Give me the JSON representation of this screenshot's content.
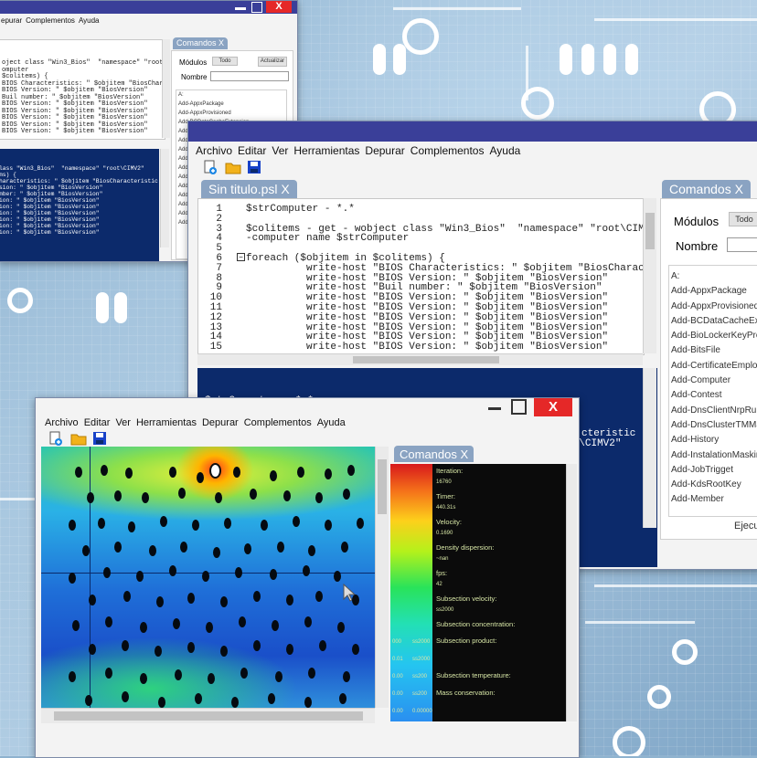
{
  "menu": [
    "Archivo",
    "Editar",
    "Ver",
    "Herramientas",
    "Depurar",
    "Complementos",
    "Ayuda"
  ],
  "back_window": {
    "menu": [
      "epurar",
      "Complementos",
      "Ayuda"
    ],
    "commands_tab": "Comandos  X",
    "modules_label": "Módulos",
    "modules_value": "Todo",
    "update_button": "Actualizar",
    "name_label": "Nombre",
    "commands": [
      "A:",
      "Add-AppxPackage",
      "Add-AppxProvisioned",
      "Add-BCDataCacheExtension",
      "Add-",
      "Add-",
      "Add-",
      "Add-",
      "Add-",
      "Add-",
      "Add-",
      "Add-",
      "Add-",
      "Add-",
      "Add-"
    ],
    "code": [
      "oject class \"Win3_Bios\"  \"namespace\" \"root\\CIMV",
      "omputer",
      "",
      "$colitems) {",
      "BIOS Characteristics: \" $objitem \"BiosCharacter",
      "BIOS Version: \" $objitem \"BiosVersion\"",
      "Buil number: \" $objitem \"BiosVersion\"",
      "BIOS Version: \" $objitem \"BiosVersion\"",
      "BIOS Version: \" $objitem \"BiosVersion\"",
      "BIOS Version: \" $objitem \"BiosVersion\"",
      "BIOS Version: \" $objitem \"BiosVersion\"",
      "BIOS Version: \" $objitem \"BiosVersion\""
    ],
    "console": [
      "lass \"Win3_Bios\"  \"namespace\" \"root\\CIMV2\"",
      "",
      "ms) {",
      "haracteristics: \" $objitem \"BiosCharacteristic",
      "sion: \" $objitem \"BiosVersion\"",
      "mber: \" $objitem \"BiosVersion\"",
      "ion: \" $objitem \"BiosVersion\"",
      "ion: \" $objitem \"BiosVersion\"",
      "ion: \" $objitem \"BiosVersion\"",
      "ion: \" $objitem \"BiosVersion\"",
      "ion: \" $objitem \"BiosVersion\"",
      "ion: \" $objitem \"BiosVersion\""
    ]
  },
  "mid_window": {
    "file_tab": "Sin titulo.psl  X",
    "commands_tab": "Comandos  X",
    "modules_label": "Módulos",
    "modules_value": "Todo",
    "name_label": "Nombre",
    "execute_button": "Ejecu",
    "commands": [
      "A:",
      "Add-AppxPackage",
      "Add-AppxProvisioned",
      "Add-BCDataCacheExt",
      "Add-BioLockerKeyPro",
      "Add-BitsFile",
      "Add-CertificateEmploy",
      "Add-Computer",
      "Add-Contest",
      "Add-DnsClientNrpRule",
      "Add-DnsClusterTMMa",
      "Add-History",
      "Add-InstalationMaskin",
      "Add-JobTrigget",
      "Add-KdsRootKey",
      "Add-Member"
    ],
    "line_numbers": [
      "1",
      "2",
      "3",
      "4",
      "5",
      "6",
      "7",
      "8",
      "9",
      "10",
      "11",
      "12",
      "13",
      "14",
      "15"
    ],
    "code": [
      "$strComputer - *.*",
      "",
      "$colitems - get - wobject class \"Win3_Bios\"  \"namespace\" \"root\\CIMV",
      "-computer name $strComputer",
      "",
      "foreach ($objitem in $colitems) {",
      "          write-host \"BIOS Characteristics: \" $objitem \"BiosCharacter",
      "          write-host \"BIOS Version: \" $objitem \"BiosVersion\"",
      "          write-host \"Buil number: \" $objitem \"BiosVersion\"",
      "          write-host \"BIOS Version: \" $objitem \"BiosVersion\"",
      "          write-host \"BIOS Version: \" $objitem \"BiosVersion\"",
      "          write-host \"BIOS Version: \" $objitem \"BiosVersion\"",
      "          write-host \"BIOS Version: \" $objitem \"BiosVersion\"",
      "          write-host \"BIOS Version: \" $objitem \"BiosVersion\"",
      "          write-host \"BIOS Version: \" $objitem \"BiosVersion\""
    ],
    "console_line1": "$strComputer - *.*",
    "console_line2": "$colitems - get - wobject class \"Win3_Bios\"  \"namespace\" \"root\\CIMV2\"",
    "console_line3": "cteristic"
  },
  "front_window": {
    "commands_tab": "Comandos  X",
    "stats": [
      {
        "label": "Iteration:",
        "value": "16760"
      },
      {
        "label": "Timer:",
        "value": "440.31s"
      },
      {
        "label": "Velocity:",
        "value": "0.1690"
      },
      {
        "label": "Density dispersion:",
        "value": "~nan"
      },
      {
        "label": "fps:",
        "value": "42"
      },
      {
        "label": "Subsection velocity:",
        "value": "ss2000"
      },
      {
        "label": "Subsection concentration:",
        "value": ""
      }
    ],
    "stats_rows": [
      {
        "n": "000",
        "v": "ss2000",
        "label": "Subsection product:"
      },
      {
        "n": "0.01",
        "v": "ss2000",
        "label": ""
      },
      {
        "n": "0.00",
        "v": "ss200",
        "label": "Subsection temperature:"
      },
      {
        "n": "0.00",
        "v": "ss200",
        "label": "Mass conservation:"
      },
      {
        "n": "0.00",
        "v": "0.00000",
        "label": ""
      }
    ]
  },
  "colors": {
    "accent": "#3a3f99",
    "close": "#e52828",
    "console": "#0c2a6b",
    "tab": "#8aa3c2"
  }
}
